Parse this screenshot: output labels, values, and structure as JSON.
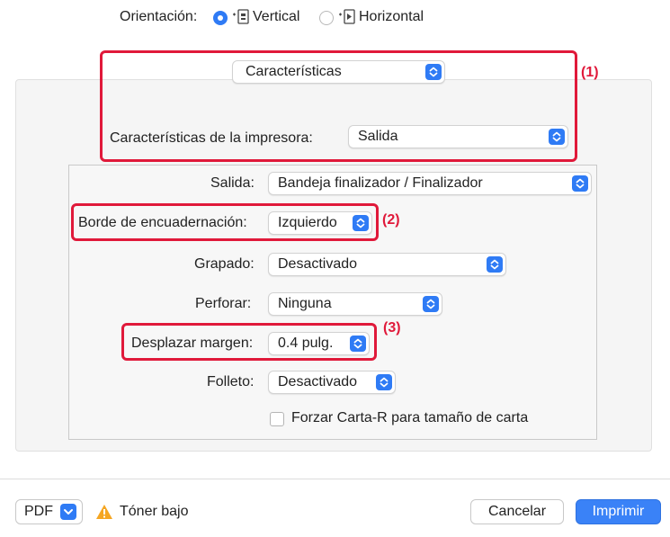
{
  "orientation": {
    "label": "Orientación:",
    "options": [
      {
        "label": "Vertical",
        "selected": true
      },
      {
        "label": "Horizontal",
        "selected": false
      }
    ]
  },
  "section_popup": {
    "value": "Características"
  },
  "printer_features": {
    "label": "Características de la impresora:",
    "value": "Salida"
  },
  "fields": {
    "salida": {
      "label": "Salida:",
      "value": "Bandeja finalizador / Finalizador"
    },
    "borde": {
      "label": "Borde de encuadernación:",
      "value": "Izquierdo"
    },
    "grapado": {
      "label": "Grapado:",
      "value": "Desactivado"
    },
    "perforar": {
      "label": "Perforar:",
      "value": "Ninguna"
    },
    "desplazar": {
      "label": "Desplazar margen:",
      "value": "0.4 pulg."
    },
    "folleto": {
      "label": "Folleto:",
      "value": "Desactivado"
    }
  },
  "checkbox": {
    "label": "Forzar Carta-R para tamaño de carta",
    "checked": false
  },
  "callouts": [
    "(1)",
    "(2)",
    "(3)"
  ],
  "footer": {
    "pdf_label": "PDF",
    "warning_text": "Tóner bajo",
    "cancel_label": "Cancelar",
    "print_label": "Imprimir"
  },
  "colors": {
    "accent": "#2f7bf5",
    "callout": "#e0193a",
    "warning": "#f5a623"
  },
  "icons": [
    "portrait-orientation-icon",
    "landscape-orientation-icon",
    "popup-stepper-icon",
    "chevron-down-icon",
    "warning-icon"
  ]
}
